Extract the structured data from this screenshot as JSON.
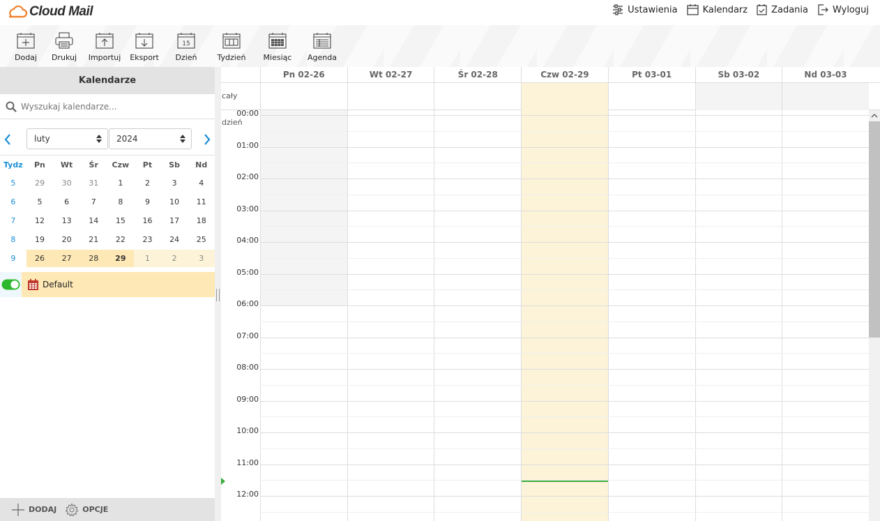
{
  "app": {
    "logo_text": "Cloud Mail"
  },
  "topnav": [
    {
      "label": "Ustawienia",
      "icon": "sliders-icon"
    },
    {
      "label": "Kalendarz",
      "icon": "calendar-icon"
    },
    {
      "label": "Zadania",
      "icon": "tasks-icon"
    },
    {
      "label": "Wyloguj",
      "icon": "logout-icon"
    }
  ],
  "toolbar": {
    "add": "Dodaj",
    "print": "Drukuj",
    "import": "Importuj",
    "export": "Eksport",
    "day": "Dzień",
    "day_icon_number": "15",
    "week": "Tydzień",
    "month": "Miesiąc",
    "agenda": "Agenda",
    "active_view": "Miesiąc"
  },
  "sidebar": {
    "title": "Kalendarze",
    "search_placeholder": "Wyszukaj kalendarze...",
    "month_select": "luty",
    "year_select": "2024",
    "weekday_header": [
      "Tydz",
      "Pn",
      "Wt",
      "Śr",
      "Czw",
      "Pt",
      "Sb",
      "Nd"
    ],
    "weeks": [
      {
        "week": "5",
        "days": [
          "29",
          "30",
          "31",
          "1",
          "2",
          "3",
          "4"
        ]
      },
      {
        "week": "6",
        "days": [
          "5",
          "6",
          "7",
          "8",
          "9",
          "10",
          "11"
        ]
      },
      {
        "week": "7",
        "days": [
          "12",
          "13",
          "14",
          "15",
          "16",
          "17",
          "18"
        ]
      },
      {
        "week": "8",
        "days": [
          "19",
          "20",
          "21",
          "22",
          "23",
          "24",
          "25"
        ]
      },
      {
        "week": "9",
        "days": [
          "26",
          "27",
          "28",
          "29",
          "1",
          "2",
          "3"
        ]
      }
    ],
    "today": "29",
    "calendars": [
      {
        "name": "Default",
        "enabled": true,
        "color": "#c0392b"
      }
    ],
    "footer": {
      "add": "DODAJ",
      "options": "OPCJE"
    }
  },
  "week_view": {
    "days": [
      "Pn 02-26",
      "Wt 02-27",
      "Śr 02-28",
      "Czw 02-29",
      "Pt 03-01",
      "Sb 03-02",
      "Nd 03-03"
    ],
    "today_index": 3,
    "all_day_label": "cały dzień",
    "hours": [
      "00:00",
      "01:00",
      "02:00",
      "03:00",
      "04:00",
      "05:00",
      "06:00",
      "07:00",
      "08:00",
      "09:00",
      "10:00",
      "11:00",
      "12:00"
    ]
  },
  "colors": {
    "accent": "#1a8fd6",
    "today_bg": "#fdf3d8",
    "highlight": "#fde8b6",
    "now": "#3cab3c",
    "toggle": "#2eb82e"
  }
}
